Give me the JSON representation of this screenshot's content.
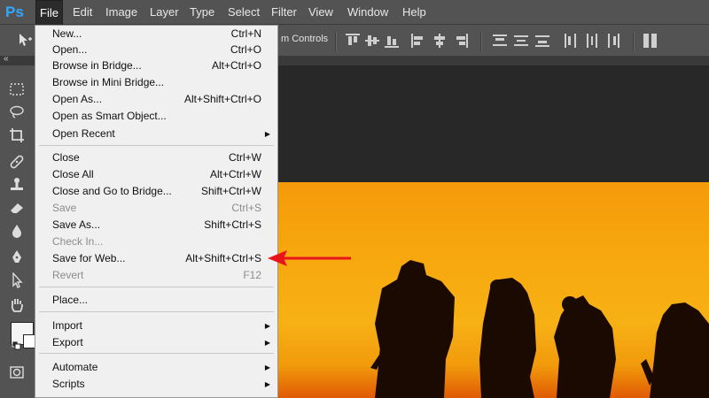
{
  "app": {
    "logo_text": "Ps",
    "accent_color": "#31a8ff"
  },
  "menubar": {
    "items": [
      {
        "label": "File",
        "active": true
      },
      {
        "label": "Edit"
      },
      {
        "label": "Image"
      },
      {
        "label": "Layer"
      },
      {
        "label": "Type"
      },
      {
        "label": "Select"
      },
      {
        "label": "Filter"
      },
      {
        "label": "View"
      },
      {
        "label": "Window"
      },
      {
        "label": "Help"
      }
    ]
  },
  "options_bar": {
    "transform_controls_text": "m Controls"
  },
  "file_menu": {
    "items": [
      {
        "label": "New...",
        "shortcut": "Ctrl+N"
      },
      {
        "label": "Open...",
        "shortcut": "Ctrl+O"
      },
      {
        "label": "Browse in Bridge...",
        "shortcut": "Alt+Ctrl+O"
      },
      {
        "label": "Browse in Mini Bridge...",
        "shortcut": ""
      },
      {
        "label": "Open As...",
        "shortcut": "Alt+Shift+Ctrl+O"
      },
      {
        "label": "Open as Smart Object...",
        "shortcut": ""
      },
      {
        "label": "Open Recent",
        "shortcut": "",
        "submenu": true
      },
      {
        "label": "Close",
        "shortcut": "Ctrl+W"
      },
      {
        "label": "Close All",
        "shortcut": "Alt+Ctrl+W"
      },
      {
        "label": "Close and Go to Bridge...",
        "shortcut": "Shift+Ctrl+W"
      },
      {
        "label": "Save",
        "shortcut": "Ctrl+S",
        "disabled": true
      },
      {
        "label": "Save As...",
        "shortcut": "Shift+Ctrl+S"
      },
      {
        "label": "Check In...",
        "shortcut": "",
        "disabled": true
      },
      {
        "label": "Save for Web...",
        "shortcut": "Alt+Shift+Ctrl+S"
      },
      {
        "label": "Revert",
        "shortcut": "F12",
        "disabled": true
      },
      {
        "label": "Place...",
        "shortcut": ""
      },
      {
        "label": "Import",
        "shortcut": "",
        "submenu": true
      },
      {
        "label": "Export",
        "shortcut": "",
        "submenu": true
      },
      {
        "label": "Automate",
        "shortcut": "",
        "submenu": true
      },
      {
        "label": "Scripts",
        "shortcut": "",
        "submenu": true
      }
    ]
  },
  "annotation": {
    "arrow_color": "#e8141b",
    "target": "Save for Web..."
  }
}
